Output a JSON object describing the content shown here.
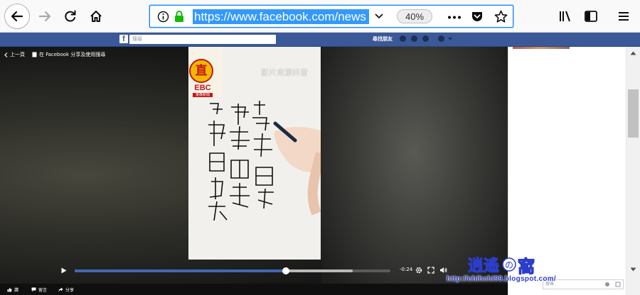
{
  "browser": {
    "url": "https://www.facebook.com/news",
    "zoom": "40%"
  },
  "fb": {
    "logo": "f",
    "search_placeholder": "搜尋",
    "user_name": "尋找朋友"
  },
  "viewer": {
    "back_label": "上一頁",
    "post_label": "在 Facebook 分享及使用搜尋",
    "video_caption": "影片來源抖音",
    "badge_top": "直",
    "badge_bottom": "EBC",
    "badge_sub": "東森新聞",
    "time_remaining": "-0:24",
    "progress_played": 0.67,
    "progress_buffered": 0.88
  },
  "actions": {
    "like": "讚",
    "comment": "留言",
    "share": "分享"
  },
  "sidebar": {
    "chat_placeholder": "搜尋"
  },
  "watermark": {
    "url": "http://chihchi99.blogspot.com/",
    "logo_text": "逍遙の窩"
  },
  "colors": {
    "fb_blue": "#3b5998",
    "url_highlight": "#3399ff",
    "progress_played": "#4267b2"
  }
}
